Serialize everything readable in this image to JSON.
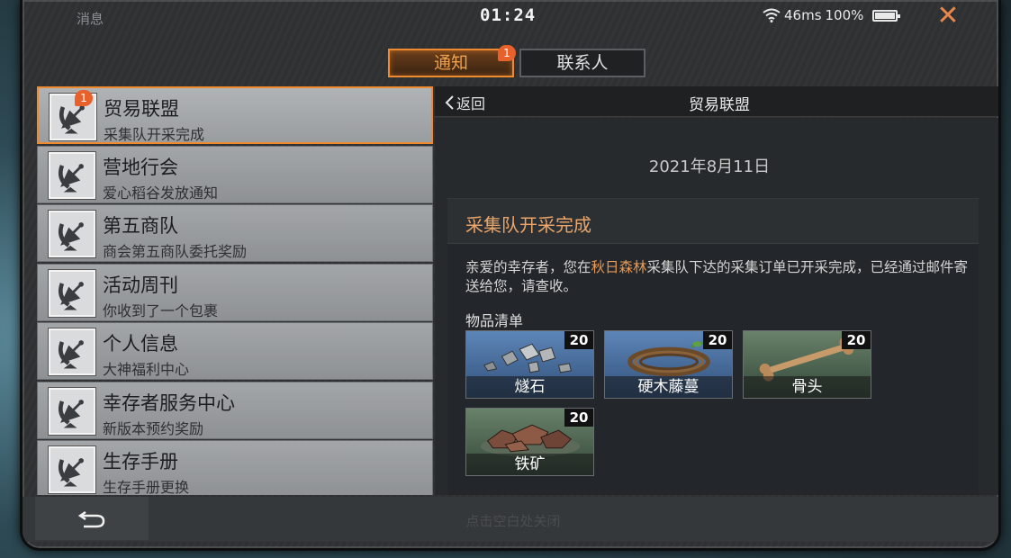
{
  "topbar": {
    "title": "消息",
    "time": "01:24",
    "latency": "46ms",
    "battery": "100%",
    "close": "✕"
  },
  "tabs": [
    {
      "label": "通知",
      "badge": "1",
      "active": true
    },
    {
      "label": "联系人",
      "active": false
    }
  ],
  "list": [
    {
      "title": "贸易联盟",
      "subtitle": "采集队开采完成",
      "badge": "1",
      "active": true
    },
    {
      "title": "营地行会",
      "subtitle": "爱心稻谷发放通知"
    },
    {
      "title": "第五商队",
      "subtitle": "商会第五商队委托奖励"
    },
    {
      "title": "活动周刊",
      "subtitle": "你收到了一个包裹"
    },
    {
      "title": "个人信息",
      "subtitle": "大神福利中心"
    },
    {
      "title": "幸存者服务中心",
      "subtitle": "新版本预约奖励"
    },
    {
      "title": "生存手册",
      "subtitle": "生存手册更换"
    }
  ],
  "detail": {
    "back_label": "返回",
    "title": "贸易联盟",
    "date": "2021年8月11日",
    "subject": "采集队开采完成",
    "body_pre": "亲爱的幸存者，您在",
    "body_highlight": "秋日森林",
    "body_post": "采集队下达的采集订单已开采完成，已经通过邮件寄送给您，请查收。",
    "items_label": "物品清单",
    "items": [
      {
        "name": "燧石",
        "qty": "20",
        "rarity": "blue"
      },
      {
        "name": "硬木藤蔓",
        "qty": "20",
        "rarity": "blue"
      },
      {
        "name": "骨头",
        "qty": "20",
        "rarity": "green"
      },
      {
        "name": "铁矿",
        "qty": "20",
        "rarity": "green"
      }
    ]
  },
  "footer": {
    "hint": "点击空白处关闭"
  },
  "colors": {
    "accent": "#f08a2e",
    "badge": "#e8612a",
    "highlight": "#e69a55"
  }
}
